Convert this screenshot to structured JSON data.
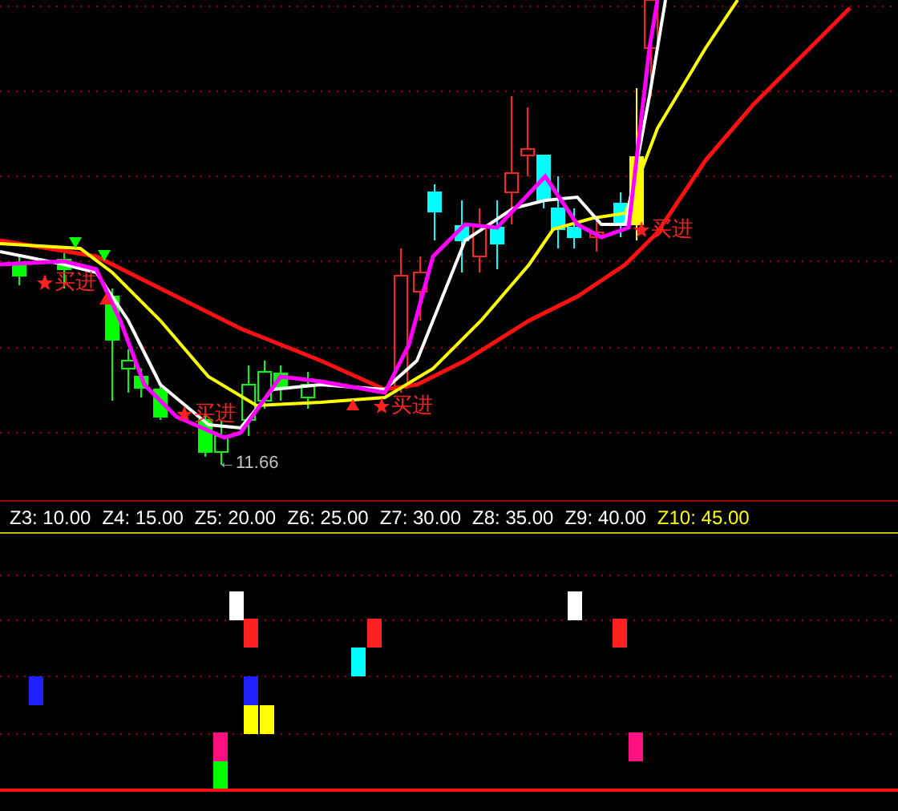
{
  "price_chart": {
    "signals": [
      {
        "text": "买进"
      },
      {
        "text": "买进"
      },
      {
        "text": "买进"
      },
      {
        "text": "买进"
      }
    ],
    "low_label": "←11.66"
  },
  "legend": [
    {
      "text": "Z3: 10.00",
      "color": "#ffffff"
    },
    {
      "text": "Z4: 15.00",
      "color": "#ffffff"
    },
    {
      "text": "Z5: 20.00",
      "color": "#ffffff"
    },
    {
      "text": "Z6: 25.00",
      "color": "#ffffff"
    },
    {
      "text": "Z7: 30.00",
      "color": "#ffffff"
    },
    {
      "text": "Z8: 35.00",
      "color": "#ffffff"
    },
    {
      "text": "Z9: 40.00",
      "color": "#ffffff"
    },
    {
      "text": "Z10: 45.00",
      "color": "#ffff00"
    }
  ]
}
